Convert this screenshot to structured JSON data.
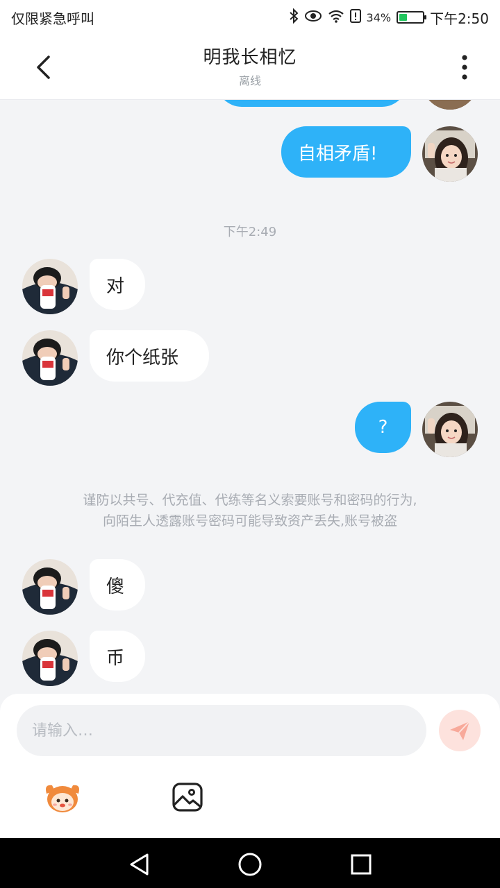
{
  "status_bar": {
    "carrier": "仅限紧急呼叫",
    "battery_percent": "34%",
    "battery_level": 0.34,
    "time": "下午2:50",
    "icons": [
      "bluetooth-icon",
      "eye-icon",
      "wifi-icon",
      "alert-icon",
      "battery-icon"
    ]
  },
  "header": {
    "title": "明我长相忆",
    "subtitle": "离线"
  },
  "messages": {
    "out_partial": "",
    "out_1": "自相矛盾!",
    "timestamp": "下午2:49",
    "in_1": "对",
    "in_2": "你个纸张",
    "out_2": "?",
    "notice_line1": "谨防以共号、代充值、代练等名义索要账号和密码的行为,",
    "notice_line2": "向陌生人透露账号密码可能导致资产丢失,账号被盗",
    "in_3": "傻",
    "in_4": "币"
  },
  "input": {
    "placeholder": "请输入…"
  },
  "colors": {
    "outgoing_bubble": "#2eb2f8",
    "incoming_bubble": "#ffffff",
    "send_button_bg": "#fde2dd",
    "send_button_icon": "#f8a99a",
    "background": "#f3f4f6"
  }
}
